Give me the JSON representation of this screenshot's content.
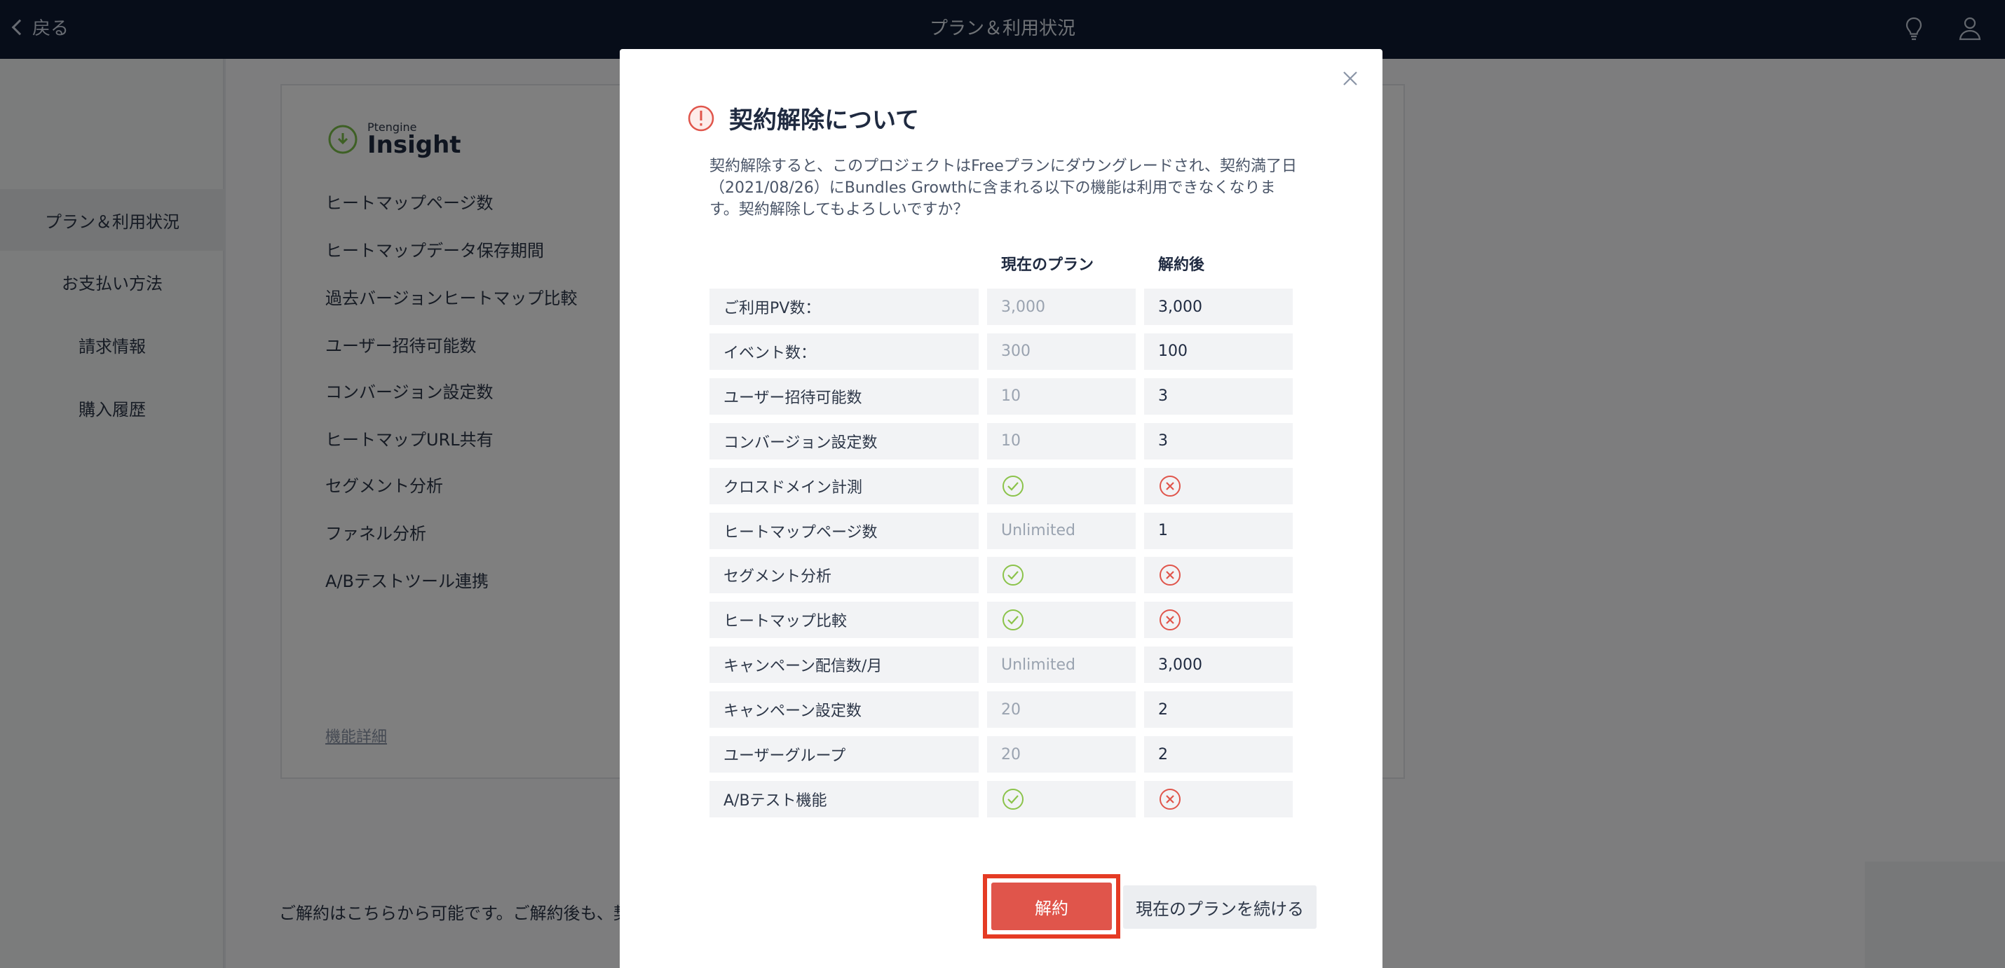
{
  "header": {
    "back_label": "戻る",
    "title": "プラン＆利用状況"
  },
  "sidebar": {
    "items": [
      {
        "label": "プラン＆利用状況"
      },
      {
        "label": "お支払い方法"
      },
      {
        "label": "請求情報"
      },
      {
        "label": "購入履歴"
      }
    ]
  },
  "content": {
    "logo_small": "Ptengine",
    "logo_main": "Insight",
    "features": [
      "ヒートマップページ数",
      "ヒートマップデータ保存期間",
      "過去バージョンヒートマップ比較",
      "ユーザー招待可能数",
      "コンバージョン設定数",
      "ヒートマップURL共有",
      "セグメント分析",
      "ファネル分析",
      "A/Bテストツール連携"
    ],
    "detail_link": "機能詳細",
    "bottom_note": "ご解約はこちらから可能です。ご解約後も、契約"
  },
  "modal": {
    "title": "契約解除について",
    "description": "契約解除すると、このプロジェクトはFreeプランにダウングレードされ、契約満了日（2021/08/26）にBundles Growthに含まれる以下の機能は利用できなくなります。契約解除してもよろしいですか？",
    "col_current": "現在のプラン",
    "col_after": "解約後",
    "rows": [
      {
        "label": "ご利用PV数：",
        "current": "3,000",
        "after": "3,000"
      },
      {
        "label": "イベント数：",
        "current": "300",
        "after": "100"
      },
      {
        "label": "ユーザー招待可能数",
        "current": "10",
        "after": "3"
      },
      {
        "label": "コンバージョン設定数",
        "current": "10",
        "after": "3"
      },
      {
        "label": "クロスドメイン計測",
        "current": "check",
        "after": "cross"
      },
      {
        "label": "ヒートマップページ数",
        "current": "Unlimited",
        "after": "1"
      },
      {
        "label": "セグメント分析",
        "current": "check",
        "after": "cross"
      },
      {
        "label": "ヒートマップ比較",
        "current": "check",
        "after": "cross"
      },
      {
        "label": "キャンペーン配信数/月",
        "current": "Unlimited",
        "after": "3,000"
      },
      {
        "label": "キャンペーン設定数",
        "current": "20",
        "after": "2"
      },
      {
        "label": "ユーザーグループ",
        "current": "20",
        "after": "2"
      },
      {
        "label": "A/Bテスト機能",
        "current": "check",
        "after": "cross"
      }
    ],
    "cancel_button": "解約",
    "continue_button": "現在のプランを続ける"
  },
  "colors": {
    "topbar": "#0e1a33",
    "danger": "#e0554b",
    "highlight": "#e53b24",
    "check": "#8bc34a",
    "cross": "#e0554b"
  }
}
